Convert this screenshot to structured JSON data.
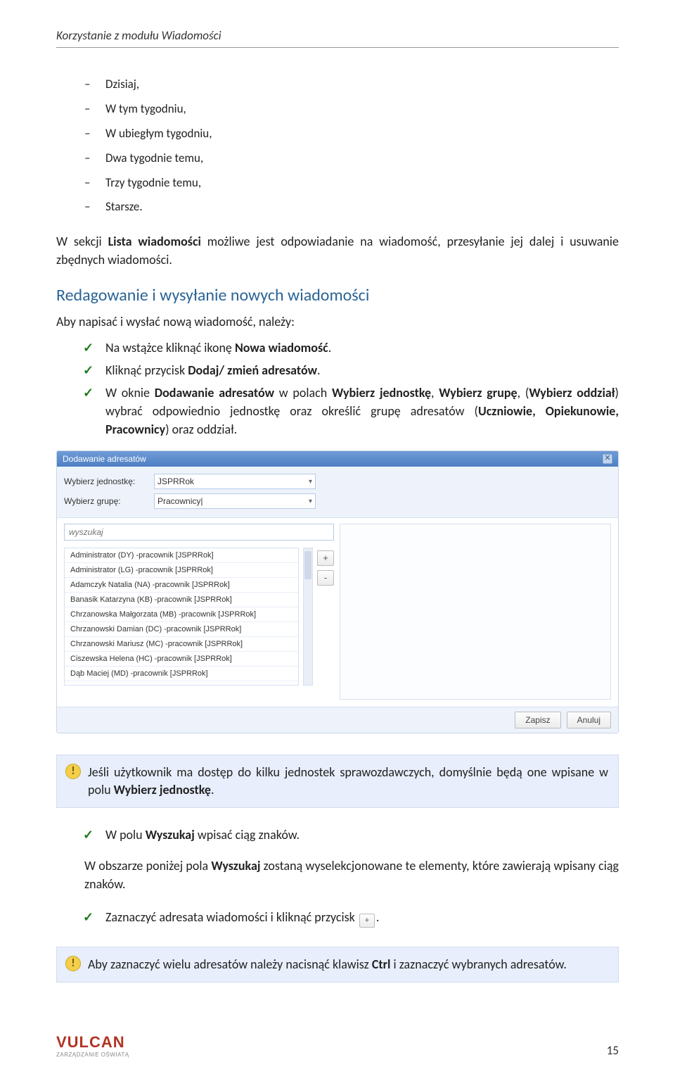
{
  "header": {
    "title": "Korzystanie z modułu Wiadomości"
  },
  "dash_list": [
    "Dzisiaj,",
    "W tym tygodniu,",
    "W ubiegłym tygodniu,",
    "Dwa tygodnie temu,",
    "Trzy tygodnie temu,",
    "Starsze."
  ],
  "para1_pre": "W sekcji ",
  "para1_b1": "Lista wiadomości",
  "para1_post": " możliwe jest odpowiadanie na wiadomość, przesyłanie jej dalej i usuwanie zbędnych wiadomości.",
  "h2": "Redagowanie i wysyłanie nowych wiadomości",
  "intro2": "Aby napisać i wysłać nową wiadomość, należy:",
  "check1": {
    "pre": "Na wstążce kliknąć ikonę ",
    "b": "Nowa wiadomość",
    "post": "."
  },
  "check2": {
    "pre": "Kliknąć przycisk ",
    "b": "Dodaj/ zmień adresatów",
    "post": "."
  },
  "check3": {
    "p1": "W oknie ",
    "b1": "Dodawanie adresatów",
    "p2": " w polach ",
    "b2": "Wybierz jednostkę",
    "p3": ", ",
    "b3": "Wybierz grupę",
    "p4": ", (",
    "b4": "Wybierz oddział",
    "p5": ") wybrać odpowiednio jednostkę oraz określić grupę adresatów (",
    "b5": "Uczniowie, Opiekunowie, Pracownicy",
    "p6": ") oraz oddział."
  },
  "dialog": {
    "title": "Dodawanie adresatów",
    "label_unit": "Wybierz jednostkę:",
    "label_group": "Wybierz grupę:",
    "unit_value": "JSPRRok",
    "group_value": "Pracownicy|",
    "search_placeholder": "wyszukaj",
    "add_btn": "+",
    "remove_btn": "-",
    "rows": [
      "Administrator (DY) -pracownik [JSPRRok]",
      "Administrator (LG) -pracownik [JSPRRok]",
      "Adamczyk Natalia (NA) -pracownik [JSPRRok]",
      "Banasik Katarzyna (KB) -pracownik [JSPRRok]",
      "Chrzanowska Małgorzata (MB) -pracownik [JSPRRok]",
      "Chrzanowski Damian (DC) -pracownik [JSPRRok]",
      "Chrzanowski Mariusz (MC) -pracownik [JSPRRok]",
      "Ciszewska Helena (HC) -pracownik [JSPRRok]",
      "Dąb Maciej (MD) -pracownik [JSPRRok]"
    ],
    "save": "Zapisz",
    "cancel": "Anuluj"
  },
  "info1": {
    "pre": "Jeśli użytkownik ma dostęp do kilku jednostek sprawozdawczych, domyślnie będą one wpisane w polu ",
    "b": "Wybierz jednostkę",
    "post": "."
  },
  "check4": {
    "pre": "W polu ",
    "b": "Wyszukaj",
    "post": " wpisać ciąg znaków."
  },
  "para2": {
    "pre": "W obszarze poniżej pola ",
    "b": "Wyszukaj",
    "post": " zostaną wyselekcjonowane te elementy, które zawierają wpisany ciąg znaków."
  },
  "check5": {
    "pre": "Zaznaczyć adresata wiadomości i kliknąć przycisk ",
    "btn": "+",
    "post": "."
  },
  "info2": {
    "pre": "Aby zaznaczyć wielu adresatów należy nacisnąć klawisz ",
    "b": "Ctrl",
    "post": " i zaznaczyć wybranych adresatów."
  },
  "footer": {
    "brand": "VULCAN",
    "tagline": "ZARZĄDZANIE OŚWIATĄ",
    "page": "15"
  }
}
